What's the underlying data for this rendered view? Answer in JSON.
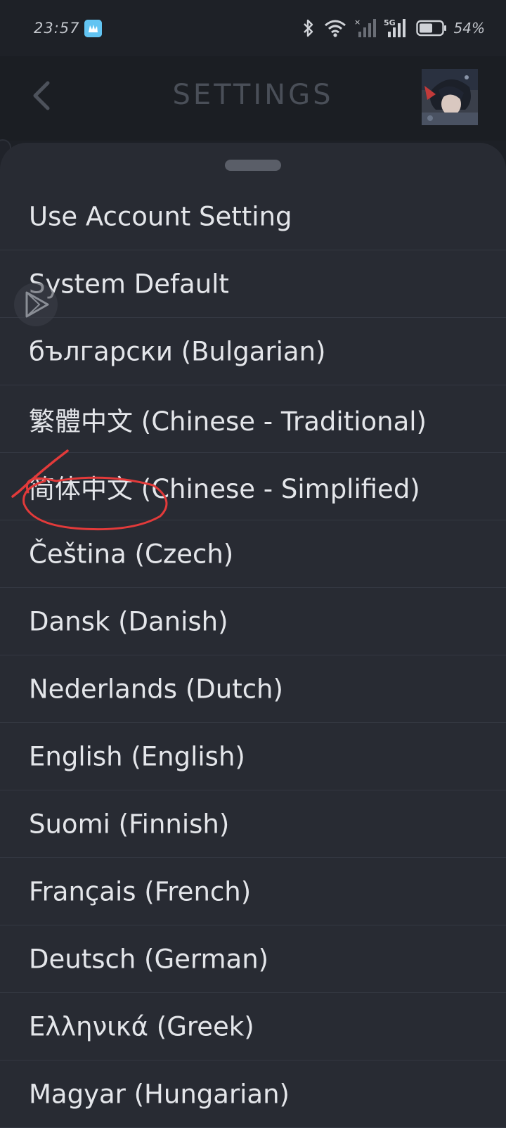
{
  "status_bar": {
    "time": "23:57",
    "battery_percent": "54%",
    "icons": [
      "app-notification-icon",
      "bluetooth-icon",
      "wifi-icon",
      "signal-no-sim-icon",
      "signal-5g-icon",
      "battery-icon"
    ],
    "network_label": "5G"
  },
  "header": {
    "title": "SETTINGS"
  },
  "languages": {
    "items": [
      {
        "label": "Use Account Setting"
      },
      {
        "label": "System Default"
      },
      {
        "label": "български (Bulgarian)"
      },
      {
        "label": "繁體中文 (Chinese - Traditional)"
      },
      {
        "label": "简体中文 (Chinese - Simplified)"
      },
      {
        "label": "Čeština (Czech)"
      },
      {
        "label": "Dansk (Danish)"
      },
      {
        "label": "Nederlands (Dutch)"
      },
      {
        "label": "English (English)"
      },
      {
        "label": "Suomi (Finnish)"
      },
      {
        "label": "Français (French)"
      },
      {
        "label": "Deutsch (German)"
      },
      {
        "label": "Ελληνικά (Greek)"
      },
      {
        "label": "Magyar (Hungarian)"
      }
    ]
  },
  "colors": {
    "sheet_background": "#282b33",
    "header_background": "#1b1e23",
    "text": "#e4e6ea",
    "annotation_red": "#e23a3a"
  }
}
